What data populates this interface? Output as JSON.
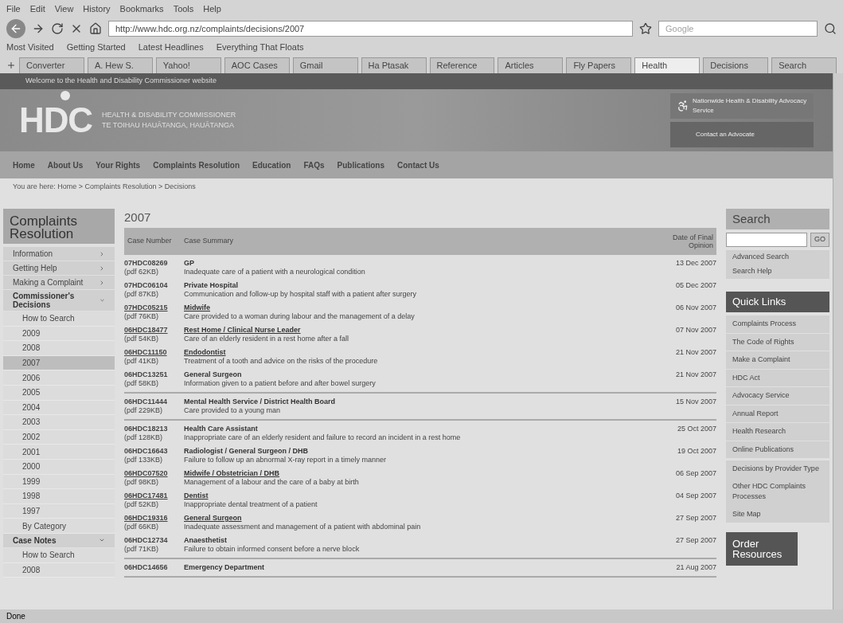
{
  "browser": {
    "menu": [
      "File",
      "Edit",
      "View",
      "History",
      "Bookmarks",
      "Tools",
      "Help"
    ],
    "url": "http://www.hdc.org.nz/complaints/decisions/2007",
    "search_placeholder": "Google",
    "bookmarks": [
      "Most Visited",
      "Getting Started",
      "Latest Headlines",
      "Everything That Floats"
    ],
    "tabs": [
      {
        "label": "Converter",
        "selected": false
      },
      {
        "label": "A. Hew S.",
        "selected": false
      },
      {
        "label": "Yahoo!",
        "selected": false
      },
      {
        "label": "AOC Cases",
        "selected": false
      },
      {
        "label": "Gmail",
        "selected": false
      },
      {
        "label": "Ha Ptasak",
        "selected": false
      },
      {
        "label": "Reference",
        "selected": false
      },
      {
        "label": "Articles",
        "selected": false
      },
      {
        "label": "Fly Papers",
        "selected": false
      },
      {
        "label": "Health",
        "selected": true
      },
      {
        "label": "Decisions",
        "selected": false
      },
      {
        "label": "Search",
        "selected": false
      }
    ],
    "status": "Done"
  },
  "site": {
    "top_bar": "Welcome to the Health and Disability Commissioner website",
    "logo": "HDC",
    "title": "HEALTH & DISABILITY COMMISSIONER",
    "subtitle": "TE TOIHAU HAUĀTANGA, HAUĀTANGA",
    "advocacy": {
      "title": "Nationwide Health & Disability Advocacy Service",
      "link": "Contact an Advocate"
    },
    "nav": [
      "Home",
      "About Us",
      "Your Rights",
      "Complaints Resolution",
      "Education",
      "FAQs",
      "Publications",
      "Contact Us"
    ],
    "breadcrumb": "You are here: Home > Complaints Resolution > Decisions",
    "sidebar": {
      "title": "Complaints Resolution",
      "items": [
        {
          "label": "Information",
          "expanded": false
        },
        {
          "label": "Getting Help",
          "expanded": false
        },
        {
          "label": "Making a Complaint",
          "expanded": false
        },
        {
          "label": "Commissioner's Decisions",
          "expanded": true,
          "children": [
            {
              "label": "How to Search",
              "selected": false
            },
            {
              "label": "2009",
              "selected": false
            },
            {
              "label": "2008",
              "selected": false
            },
            {
              "label": "2007",
              "selected": true
            },
            {
              "label": "2006",
              "selected": false
            },
            {
              "label": "2005",
              "selected": false
            },
            {
              "label": "2004",
              "selected": false
            },
            {
              "label": "2003",
              "selected": false
            },
            {
              "label": "2002",
              "selected": false
            },
            {
              "label": "2001",
              "selected": false
            },
            {
              "label": "2000",
              "selected": false
            },
            {
              "label": "1999",
              "selected": false
            },
            {
              "label": "1998",
              "selected": false
            },
            {
              "label": "1997",
              "selected": false
            },
            {
              "label": "By Category",
              "selected": false
            }
          ]
        },
        {
          "label": "Case Notes",
          "expanded": true,
          "children": [
            {
              "label": "How to Search",
              "selected": false
            },
            {
              "label": "2008",
              "selected": false
            }
          ]
        }
      ]
    },
    "heading": "2007",
    "columns": [
      "Case Number",
      "Case Summary",
      "Date of Final Opinion"
    ],
    "groups": [
      [
        {
          "case": "07HDC08269",
          "file": "(pdf 62KB)",
          "title": "GP",
          "linked": false,
          "summary": "Inadequate care of a patient with a neurological condition",
          "date": "13 Dec 2007"
        },
        {
          "case": "07HDC06104",
          "file": "(pdf 87KB)",
          "title": "Private Hospital",
          "linked": false,
          "summary": "Communication and follow-up by hospital staff with a patient after surgery",
          "date": "05 Dec 2007"
        },
        {
          "case": "07HDC05215",
          "file": "(pdf 76KB)",
          "title": "Midwife",
          "linked": true,
          "summary": "Care provided to a woman during labour and the management of a delay",
          "date": "06 Nov 2007"
        },
        {
          "case": "06HDC18477",
          "file": "(pdf 54KB)",
          "title": "Rest Home / Clinical Nurse Leader",
          "linked": true,
          "summary": "Care of an elderly resident in a rest home after a fall",
          "date": "07 Nov 2007"
        },
        {
          "case": "06HDC11150",
          "file": "(pdf 41KB)",
          "title": "Endodontist",
          "linked": true,
          "summary": "Treatment of a tooth and advice on the risks of the procedure",
          "date": "21 Nov 2007"
        },
        {
          "case": "06HDC13251",
          "file": "(pdf 58KB)",
          "title": "General Surgeon",
          "linked": false,
          "summary": "Information given to a patient before and after bowel surgery",
          "date": "21 Nov 2007"
        }
      ],
      [
        {
          "case": "06HDC11444",
          "file": "(pdf 229KB)",
          "title": "Mental Health Service / District Health Board",
          "linked": false,
          "summary": "Care provided to a young man",
          "date": "15 Nov 2007"
        }
      ],
      [
        {
          "case": "06HDC18213",
          "file": "(pdf 128KB)",
          "title": "Health Care Assistant",
          "linked": false,
          "summary": "Inappropriate care of an elderly resident and failure to record an incident in a rest home",
          "date": "25 Oct 2007"
        },
        {
          "case": "06HDC16643",
          "file": "(pdf 133KB)",
          "title": "Radiologist / General Surgeon / DHB",
          "linked": false,
          "summary": "Failure to follow up an abnormal X-ray report in a timely manner",
          "date": "19 Oct 2007"
        },
        {
          "case": "06HDC07520",
          "file": "(pdf 98KB)",
          "title": "Midwife / Obstetrician / DHB",
          "linked": true,
          "summary": "Management of a labour and the care of a baby at birth",
          "date": "06 Sep 2007"
        },
        {
          "case": "06HDC17481",
          "file": "(pdf 52KB)",
          "title": "Dentist",
          "linked": true,
          "summary": "Inappropriate dental treatment of a patient",
          "date": "04 Sep 2007"
        },
        {
          "case": "06HDC19316",
          "file": "(pdf 66KB)",
          "title": "General Surgeon",
          "linked": true,
          "summary": "Inadequate assessment and management of a patient with abdominal pain",
          "date": "27 Sep 2007"
        },
        {
          "case": "06HDC12734",
          "file": "(pdf 71KB)",
          "title": "Anaesthetist",
          "linked": false,
          "summary": "Failure to obtain informed consent before a nerve block",
          "date": "27 Sep 2007"
        }
      ],
      [
        {
          "case": "06HDC14656",
          "title": "Emergency Department",
          "linked": false,
          "date": "21 Aug 2007"
        }
      ]
    ],
    "search": {
      "title": "Search",
      "button": "GO",
      "links": [
        "Advanced Search",
        "Search Help"
      ]
    },
    "quick_links": {
      "title": "Quick Links",
      "items": [
        "Complaints Process",
        "The Code of Rights",
        "Make a Complaint",
        "HDC Act",
        "Advocacy Service",
        "Annual Report",
        "Health Research",
        "Online Publications"
      ],
      "extra": [
        "Decisions by Provider Type",
        "Other HDC Complaints Processes",
        "Site Map"
      ]
    },
    "order": "Order Resources"
  }
}
